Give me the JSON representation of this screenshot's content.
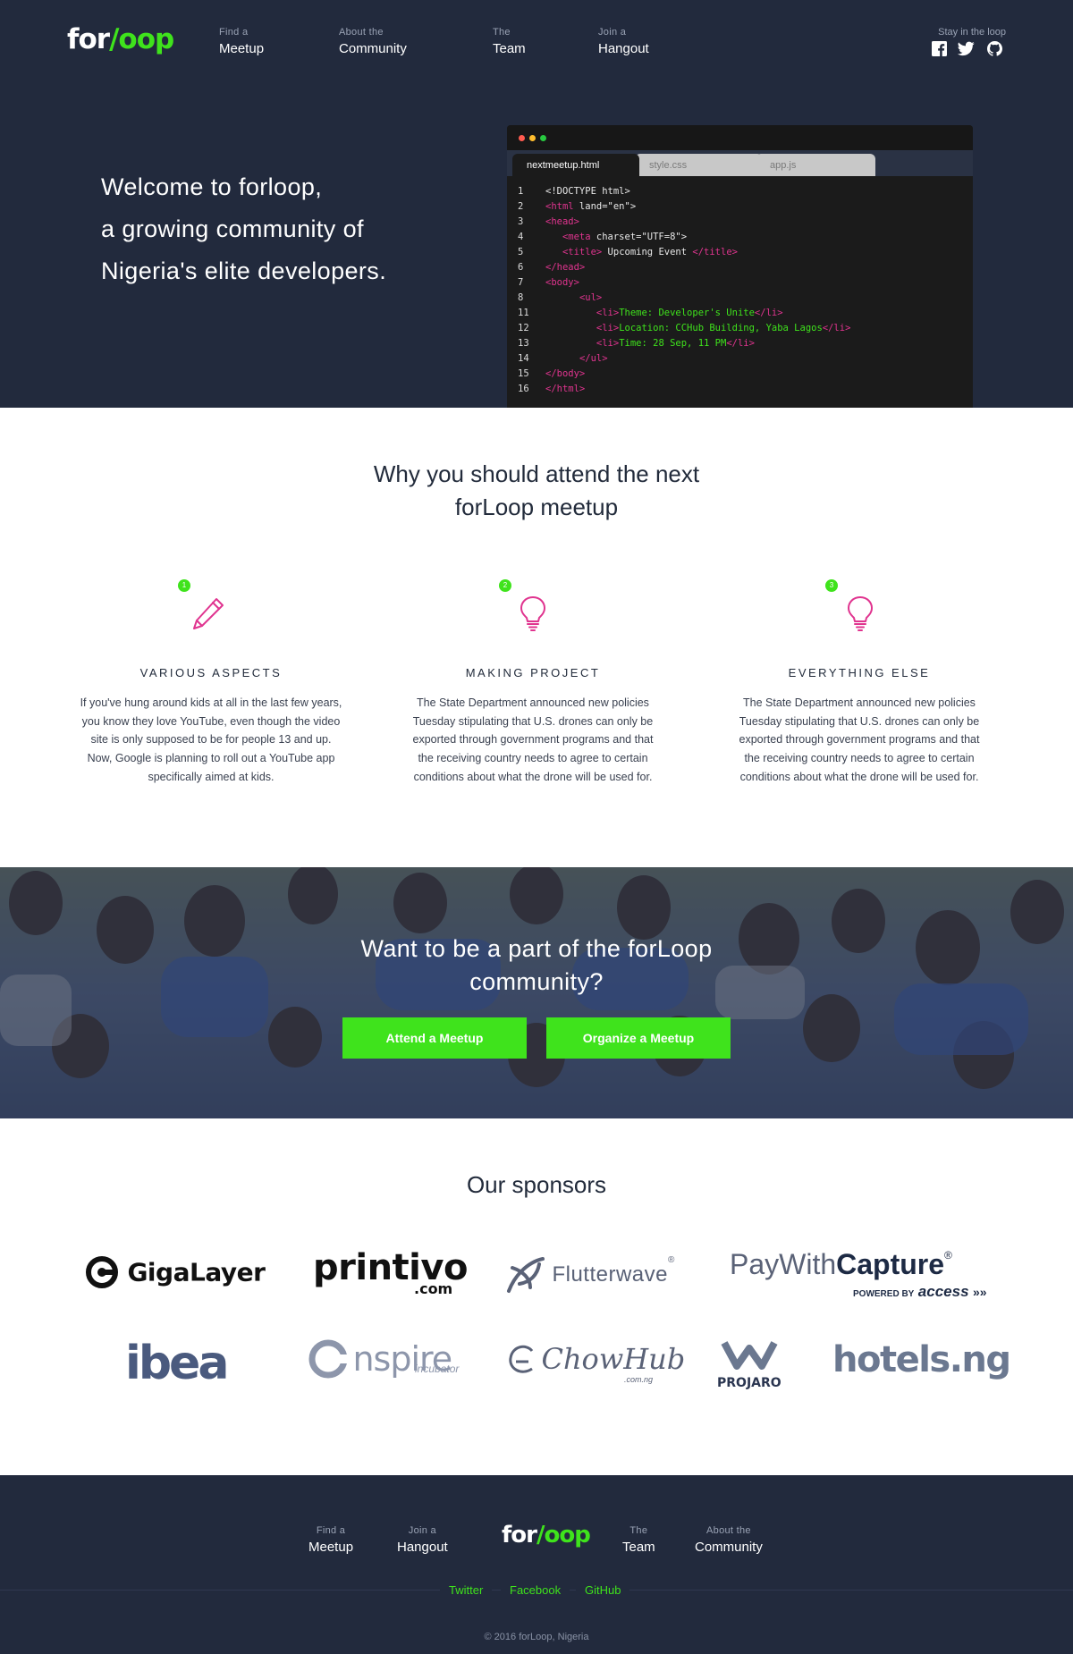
{
  "header": {
    "logo": {
      "white": "for",
      "slash": "/",
      "green": "oop"
    },
    "nav": [
      {
        "small": "Find a",
        "big": "Meetup"
      },
      {
        "small": "About the",
        "big": "Community"
      },
      {
        "small": "The",
        "big": "Team"
      },
      {
        "small": "Join a",
        "big": "Hangout"
      }
    ],
    "stay_label": "Stay in the loop",
    "social_icons": [
      "facebook-icon",
      "twitter-icon",
      "github-icon"
    ]
  },
  "hero": {
    "lines": [
      "Welcome to forloop,",
      "a growing community of",
      "Nigeria's elite developers."
    ]
  },
  "code_window": {
    "tabs": [
      "nextmeetup.html",
      "style.css",
      "app.js"
    ],
    "line_numbers": [
      "1",
      "2",
      "3",
      "4",
      "5",
      "6",
      "7",
      "8",
      "11",
      "12",
      "13",
      "14",
      "15",
      "16"
    ],
    "lines": [
      {
        "pre": "",
        "tag1": "",
        "mid": "<!DOCTYPE html>",
        "content": "",
        "tag2": "",
        "post": ""
      },
      {
        "pre": "",
        "tag1": "<html",
        "mid": " land=\"en\">",
        "content": "",
        "tag2": "",
        "post": ""
      },
      {
        "pre": "",
        "tag1": "<head>",
        "mid": "",
        "content": "",
        "tag2": "",
        "post": ""
      },
      {
        "pre": "   ",
        "tag1": "<meta",
        "mid": " charset=\"UTF=8\">",
        "content": "",
        "tag2": "",
        "post": ""
      },
      {
        "pre": "   ",
        "tag1": "<title>",
        "mid": " Upcoming Event ",
        "content": "",
        "tag2": "</title>",
        "post": ""
      },
      {
        "pre": "",
        "tag1": "</head>",
        "mid": "",
        "content": "",
        "tag2": "",
        "post": ""
      },
      {
        "pre": "",
        "tag1": "<body>",
        "mid": "",
        "content": "",
        "tag2": "",
        "post": ""
      },
      {
        "pre": "      ",
        "tag1": "<ul>",
        "mid": "",
        "content": "",
        "tag2": "",
        "post": ""
      },
      {
        "pre": "         ",
        "tag1": "<li>",
        "mid": "",
        "content": "Theme: Developer's Unite",
        "tag2": "</li>",
        "post": ""
      },
      {
        "pre": "         ",
        "tag1": "<li>",
        "mid": "",
        "content": "Location: CCHub Building, Yaba Lagos",
        "tag2": "</li>",
        "post": ""
      },
      {
        "pre": "         ",
        "tag1": "<li>",
        "mid": "",
        "content": "Time: 28 Sep, 11 PM",
        "tag2": "</li>",
        "post": ""
      },
      {
        "pre": "      ",
        "tag1": "</ul>",
        "mid": "",
        "content": "",
        "tag2": "",
        "post": ""
      },
      {
        "pre": "",
        "tag1": "</body>",
        "mid": "",
        "content": "",
        "tag2": "",
        "post": ""
      },
      {
        "pre": "",
        "tag1": "</html>",
        "mid": "",
        "content": "",
        "tag2": "",
        "post": ""
      }
    ]
  },
  "why": {
    "title_line1": "Why you should attend the next",
    "title_line2": "forLoop meetup",
    "features": [
      {
        "num": "1",
        "icon": "pencil-icon",
        "title": "VARIOUS ASPECTS",
        "body": [
          "If you've hung around kids at all in the last few years,",
          "you know they love YouTube, even though the video",
          "site is only supposed to be for people 13 and up.",
          "Now, Google is planning to roll out a YouTube app",
          "specifically aimed at kids."
        ]
      },
      {
        "num": "2",
        "icon": "lightbulb-icon",
        "title": "MAKING PROJECT",
        "body": [
          "The State Department announced new policies",
          "Tuesday stipulating that U.S. drones can only be",
          "exported through government programs and that",
          "the receiving country needs to agree to certain",
          "conditions about what the drone will be used for."
        ]
      },
      {
        "num": "3",
        "icon": "lightbulb-icon",
        "title": "EVERYTHING ELSE",
        "body": [
          "The State Department announced new policies",
          "Tuesday stipulating that U.S. drones can only be",
          "exported through government programs and that",
          "the receiving country needs to agree to certain",
          "conditions about what the drone will be used for."
        ]
      }
    ]
  },
  "cta": {
    "title_line1": "Want to be a part of the forLoop",
    "title_line2": "community?",
    "attend_label": "Attend a Meetup",
    "organize_label": "Organize a Meetup"
  },
  "sponsors": {
    "title": "Our sponsors",
    "row1": [
      "GigaLayer",
      "printivo",
      ".com",
      "Flutterwave",
      "®",
      "PayWith",
      "Capture",
      "POWERED BY",
      "access"
    ],
    "row2": [
      "ibea",
      "nspire",
      "incubator",
      "ChowHub",
      ".com.ng",
      "PROJARO",
      "hotels.ng"
    ]
  },
  "footer": {
    "nav": [
      {
        "small": "Find a",
        "big": "Meetup"
      },
      {
        "small": "Join a",
        "big": "Hangout"
      },
      {
        "small": "The",
        "big": "Team"
      },
      {
        "small": "About the",
        "big": "Community"
      }
    ],
    "links": [
      "Twitter",
      "Facebook",
      "GitHub"
    ],
    "copyright": "© 2016 forLoop, Nigeria"
  },
  "colors": {
    "navy": "#222a3d",
    "green": "#3fe31c",
    "pink": "#e0348f"
  }
}
